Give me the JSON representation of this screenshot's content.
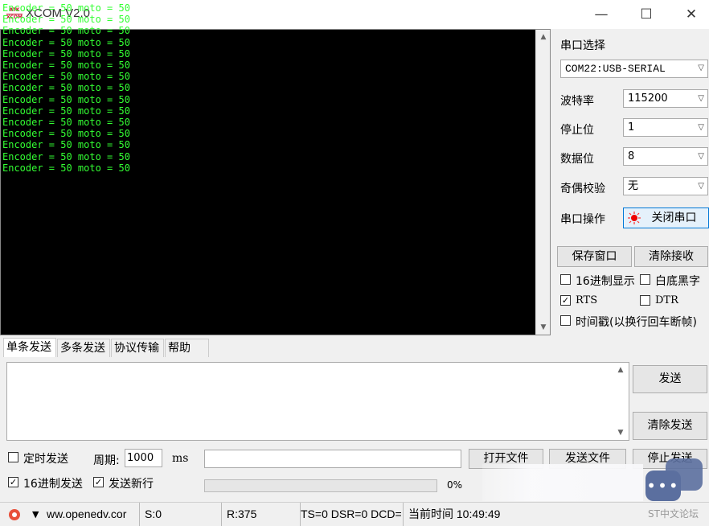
{
  "window": {
    "title": "XCOM V2.0",
    "logo_top": "ATK",
    "logo_bottom": "XCOM",
    "minimize": "—",
    "maximize": "☐",
    "close": "✕"
  },
  "receive": {
    "text_color": "#33ff33",
    "lines": [
      "Encoder = 50 moto = 50",
      "Encoder = 50 moto = 50",
      "Encoder = 50 moto = 50",
      "Encoder = 50 moto = 50",
      "Encoder = 50 moto = 50",
      "Encoder = 50 moto = 50",
      "Encoder = 50 moto = 50",
      "Encoder = 50 moto = 50",
      "Encoder = 50 moto = 50",
      "Encoder = 50 moto = 50",
      "Encoder = 50 moto = 50",
      "Encoder = 50 moto = 50",
      "Encoder = 50 moto = 50",
      "Encoder = 50 moto = 50",
      "Encoder = 50 moto = 50"
    ]
  },
  "settings": {
    "port_label": "串口选择",
    "port_value": "COM22:USB-SERIAL",
    "baud_label": "波特率",
    "baud_value": "115200",
    "stop_label": "停止位",
    "stop_value": "1",
    "data_label": "数据位",
    "data_value": "8",
    "parity_label": "奇偶校验",
    "parity_value": "无",
    "op_label": "串口操作",
    "op_button": "关闭串口"
  },
  "receive_controls": {
    "save_window": "保存窗口",
    "clear_receive": "清除接收",
    "hex_display": "16进制显示",
    "white_bg": "白底黑字",
    "rts": "RTS",
    "dtr": "DTR",
    "timestamp": "时间戳(以换行回车断帧)",
    "rts_checked": true,
    "hex_display_checked": false,
    "white_bg_checked": false,
    "dtr_checked": false,
    "timestamp_checked": false
  },
  "tabs": [
    "单条发送",
    "多条发送",
    "协议传输",
    "帮助"
  ],
  "send": {
    "send_button": "发送",
    "clear_send": "清除发送",
    "timed_send": "定时发送",
    "period_label": "周期:",
    "period_value": "1000",
    "period_unit": "ms",
    "open_file": "打开文件",
    "send_file": "发送文件",
    "stop_send": "停止发送",
    "hex_send": "16进制发送",
    "send_newline": "发送新行",
    "hex_send_checked": true,
    "send_newline_checked": true,
    "progress_text": "0%",
    "progress": 0
  },
  "status": {
    "website": "ww.openedv.cor",
    "sent": "S:0",
    "received": "R:375",
    "signals": "TS=0 DSR=0 DCD=",
    "time": "当前时间 10:49:49"
  },
  "overlay": {
    "forum": "ST中文论坛"
  }
}
